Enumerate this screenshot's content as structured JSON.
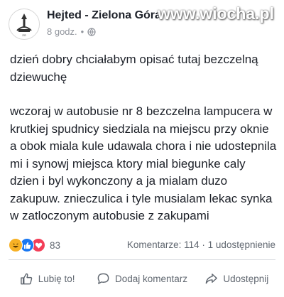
{
  "header": {
    "page_name": "Hejted - Zielona Góra",
    "time": "8 godz.",
    "separator": "•",
    "watermark": "www.wiocha.pl"
  },
  "post": {
    "paragraph_1": "dzień dobry chciałabym opisać tutaj bezczelną dziewuchę",
    "paragraph_2": "wczoraj w autobusie nr 8 bezczelna lampucera w krutkiej spudnicy siedziala na miejscu przy oknie a obok miala kule udawala chora i nie udostepnila mi i synowj miejsca ktory mial biegunke caly dzien i byl wykonczony a ja mialam duzo zakupuw. znieczulica i tyle musialam lekac synka w zatloczonym autobusie z zakupami"
  },
  "stats": {
    "reactions_count": "83",
    "comments_shares": "Komentarze: 114 · 1 udostępnienie",
    "reaction_icons": [
      "haha-icon",
      "like-icon",
      "love-icon"
    ]
  },
  "actions": {
    "like_label": "Lubię to!",
    "comment_label": "Dodaj komentarz",
    "share_label": "Udostępnij"
  },
  "colors": {
    "like_blue": "#1877f2",
    "love_red": "#f33e58",
    "haha_yellow": "#f7b125",
    "secondary_text": "#606770"
  }
}
